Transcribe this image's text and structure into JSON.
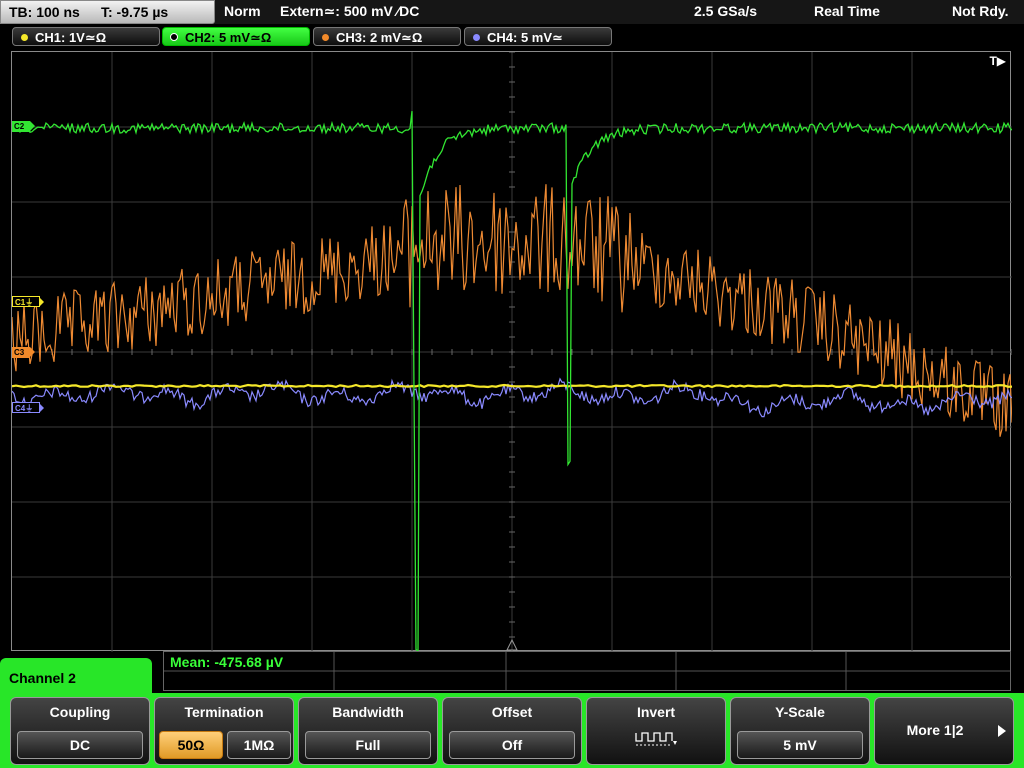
{
  "topbar": {
    "timebase": "TB: 100 ns",
    "trigger_time": "T: -9.75 µs",
    "trigger_mode": "Norm",
    "trigger_source": "Extern≃: 500 mV ∕DC",
    "sample_rate": "2.5 GSa/s",
    "acq_mode": "Real Time",
    "status": "Not Rdy."
  },
  "channels": [
    {
      "label": "CH1: 1V≃Ω",
      "color": "#f5e82a"
    },
    {
      "label": "CH2: 5 mV≃Ω",
      "color": "#2ee82e"
    },
    {
      "label": "CH3: 2 mV≃Ω",
      "color": "#f28a2a"
    },
    {
      "label": "CH4: 5 mV≃",
      "color": "#8a8aff"
    }
  ],
  "markers": {
    "c1": "C1⏚",
    "c2": "C2",
    "c3": "C3",
    "c4": "C4⏚",
    "trigger": "T▶"
  },
  "measurement": {
    "mean": "Mean: -475.68 µV"
  },
  "panel": {
    "title": "Channel 2"
  },
  "softkeys": {
    "coupling": {
      "title": "Coupling",
      "value": "DC"
    },
    "termination": {
      "title": "Termination",
      "opt1": "50Ω",
      "opt2": "1MΩ"
    },
    "bandwidth": {
      "title": "Bandwidth",
      "value": "Full"
    },
    "offset": {
      "title": "Offset",
      "value": "Off"
    },
    "invert": {
      "title": "Invert"
    },
    "yscale": {
      "title": "Y-Scale",
      "value": "5 mV"
    },
    "more": {
      "label": "More 1|2"
    }
  }
}
